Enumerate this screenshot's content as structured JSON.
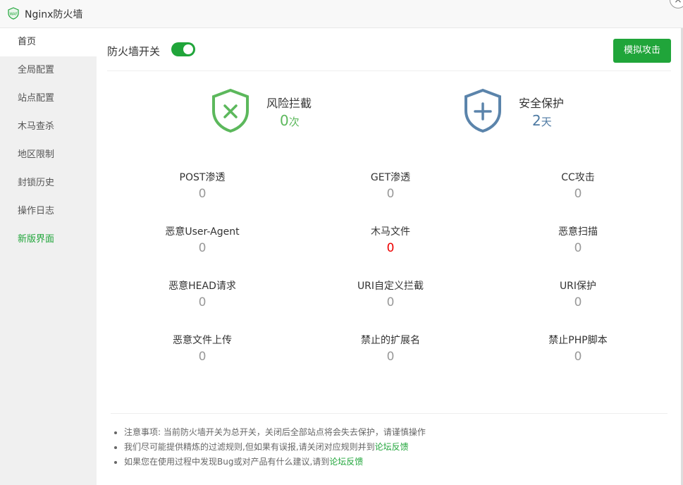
{
  "window": {
    "title": "Nginx防火墙",
    "logo_text": "WAF"
  },
  "sidebar": {
    "items": [
      {
        "label": "首页"
      },
      {
        "label": "全局配置"
      },
      {
        "label": "站点配置"
      },
      {
        "label": "木马查杀"
      },
      {
        "label": "地区限制"
      },
      {
        "label": "封锁历史"
      },
      {
        "label": "操作日志"
      },
      {
        "label": "新版界面"
      }
    ]
  },
  "header": {
    "switch_label": "防火墙开关",
    "switch_on": true,
    "attack_button": "模拟攻击"
  },
  "summary": {
    "risk": {
      "label": "风险拦截",
      "value": "0",
      "unit": "次"
    },
    "safe": {
      "label": "安全保护",
      "value": "2",
      "unit": "天"
    }
  },
  "stats": [
    {
      "label": "POST渗透",
      "value": "0"
    },
    {
      "label": "GET渗透",
      "value": "0"
    },
    {
      "label": "CC攻击",
      "value": "0"
    },
    {
      "label": "恶意User-Agent",
      "value": "0"
    },
    {
      "label": "木马文件",
      "value": "0"
    },
    {
      "label": "恶意扫描",
      "value": "0"
    },
    {
      "label": "恶意HEAD请求",
      "value": "0"
    },
    {
      "label": "URI自定义拦截",
      "value": "0"
    },
    {
      "label": "URI保护",
      "value": "0"
    },
    {
      "label": "恶意文件上传",
      "value": "0"
    },
    {
      "label": "禁止的扩展名",
      "value": "0"
    },
    {
      "label": "禁止PHP脚本",
      "value": "0"
    }
  ],
  "notes": {
    "n1": "注意事项: 当前防火墙开关为总开关，关闭后全部站点将会失去保护，请谨慎操作",
    "n2_text": "我们尽可能提供精炼的过滤规则,但如果有误报,请关闭对应规则并到",
    "n2_link": "论坛反馈",
    "n3_text": "如果您在使用过程中发现Bug或对产品有什么建议,请到",
    "n3_link": "论坛反馈"
  },
  "colors": {
    "accent": "#20a53a",
    "risk": "#5cb85c",
    "safe": "#4e7aa3",
    "alert": "#e00000"
  }
}
